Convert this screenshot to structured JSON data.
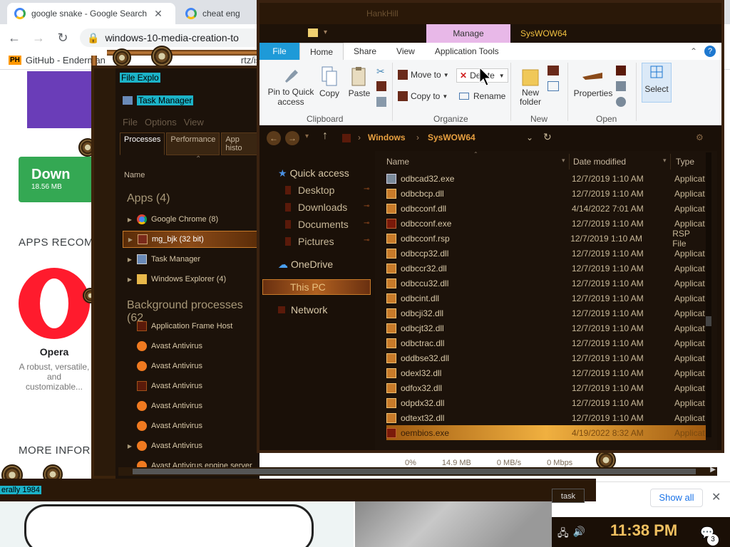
{
  "chrome": {
    "tabs": [
      {
        "label": "google snake - Google Search",
        "close": "✕"
      },
      {
        "label": "cheat eng"
      }
    ],
    "url": "windows-10-media-creation-to",
    "bookmark": {
      "badge": "PH",
      "label": "GitHub - Enderman",
      "suffix": "rtz/isos"
    },
    "download_button": {
      "label": "Down",
      "size": "18.56 MB"
    },
    "apps_recommended": "APPS RECOMME",
    "opera": {
      "name": "Opera",
      "desc": "A robust, versatile, and customizable..."
    },
    "more_info": "MORE INFORM"
  },
  "task_manager": {
    "file_explorer_label": "File Explo",
    "title": "Task Manager",
    "menu": [
      "File",
      "Options",
      "View"
    ],
    "tabs": [
      "Processes",
      "Performance",
      "App histo"
    ],
    "col_name": "Name",
    "apps_header": "Apps (4)",
    "apps": [
      {
        "label": "Google Chrome (8)",
        "icon": "chrome"
      },
      {
        "label": "mg_bjk (32 bit)",
        "icon": "mg"
      },
      {
        "label": "Task Manager",
        "icon": "taskmgr"
      },
      {
        "label": "Windows Explorer (4)",
        "icon": "folder"
      }
    ],
    "bg_header": "Background processes (62",
    "bg": [
      {
        "label": "Application Frame Host",
        "icon": "frame"
      },
      {
        "label": "Avast Antivirus",
        "icon": "avast"
      },
      {
        "label": "Avast Antivirus",
        "icon": "avast"
      },
      {
        "label": "Avast Antivirus",
        "icon": "frame"
      },
      {
        "label": "Avast Antivirus",
        "icon": "avast"
      },
      {
        "label": "Avast Antivirus",
        "icon": "avast"
      },
      {
        "label": "Avast Antivirus",
        "icon": "avast"
      },
      {
        "label": "Avast Antivirus engine server",
        "icon": "avast"
      }
    ],
    "bottom_stats": {
      "cpu": "0%",
      "mem": "14.9 MB",
      "disk": "0 MB/s",
      "net": "0 Mbps"
    },
    "selected_text": "erally 1984",
    "end_task": "task"
  },
  "explorer": {
    "title": "HankHill",
    "manage_label": "Manage",
    "location_label": "SysWOW64",
    "ribbon_tabs": [
      "File",
      "Home",
      "Share",
      "View",
      "Application Tools"
    ],
    "clipboard": {
      "pin": "Pin to Quick access",
      "copy": "Copy",
      "paste": "Paste",
      "group": "Clipboard"
    },
    "organize": {
      "move_to": "Move to",
      "copy_to": "Copy to",
      "delete": "Delete",
      "rename": "Rename",
      "group": "Organize"
    },
    "new": {
      "new_folder": "New folder",
      "group": "New"
    },
    "open": {
      "properties": "Properties",
      "group": "Open"
    },
    "select": {
      "label": "Select"
    },
    "breadcrumb": [
      "Windows",
      "SysWOW64"
    ],
    "nav": {
      "quick_access": "Quick access",
      "items": [
        "Desktop",
        "Downloads",
        "Documents",
        "Pictures"
      ],
      "onedrive": "OneDrive",
      "this_pc": "This PC",
      "network": "Network"
    },
    "columns": [
      "Name",
      "Date modified",
      "Type"
    ],
    "files": [
      {
        "name": "odbcad32.exe",
        "date": "12/7/2019 1:10 AM",
        "type": "Applicat",
        "icon": "exe"
      },
      {
        "name": "odbcbcp.dll",
        "date": "12/7/2019 1:10 AM",
        "type": "Applicat",
        "icon": "dll"
      },
      {
        "name": "odbcconf.dll",
        "date": "4/14/2022 7:01 AM",
        "type": "Applicat",
        "icon": "dll"
      },
      {
        "name": "odbcconf.exe",
        "date": "12/7/2019 1:10 AM",
        "type": "Applicat",
        "icon": "red"
      },
      {
        "name": "odbcconf.rsp",
        "date": "12/7/2019 1:10 AM",
        "type": "RSP File",
        "icon": "dll"
      },
      {
        "name": "odbccp32.dll",
        "date": "12/7/2019 1:10 AM",
        "type": "Applicat",
        "icon": "dll"
      },
      {
        "name": "odbccr32.dll",
        "date": "12/7/2019 1:10 AM",
        "type": "Applicat",
        "icon": "dll"
      },
      {
        "name": "odbccu32.dll",
        "date": "12/7/2019 1:10 AM",
        "type": "Applicat",
        "icon": "dll"
      },
      {
        "name": "odbcint.dll",
        "date": "12/7/2019 1:10 AM",
        "type": "Applicat",
        "icon": "dll"
      },
      {
        "name": "odbcji32.dll",
        "date": "12/7/2019 1:10 AM",
        "type": "Applicat",
        "icon": "dll"
      },
      {
        "name": "odbcjt32.dll",
        "date": "12/7/2019 1:10 AM",
        "type": "Applicat",
        "icon": "dll"
      },
      {
        "name": "odbctrac.dll",
        "date": "12/7/2019 1:10 AM",
        "type": "Applicat",
        "icon": "dll"
      },
      {
        "name": "oddbse32.dll",
        "date": "12/7/2019 1:10 AM",
        "type": "Applicat",
        "icon": "dll"
      },
      {
        "name": "odexl32.dll",
        "date": "12/7/2019 1:10 AM",
        "type": "Applicat",
        "icon": "dll"
      },
      {
        "name": "odfox32.dll",
        "date": "12/7/2019 1:10 AM",
        "type": "Applicat",
        "icon": "dll"
      },
      {
        "name": "odpdx32.dll",
        "date": "12/7/2019 1:10 AM",
        "type": "Applicat",
        "icon": "dll"
      },
      {
        "name": "odtext32.dll",
        "date": "12/7/2019 1:10 AM",
        "type": "Applicat",
        "icon": "dll"
      },
      {
        "name": "oembios.exe",
        "date": "4/19/2022 8:32 AM",
        "type": "Applicat",
        "icon": "red",
        "selected": true
      }
    ]
  },
  "downloads": {
    "show_all": "Show all"
  },
  "taskbar": {
    "clock": "11:38 PM",
    "notifications": "3"
  }
}
